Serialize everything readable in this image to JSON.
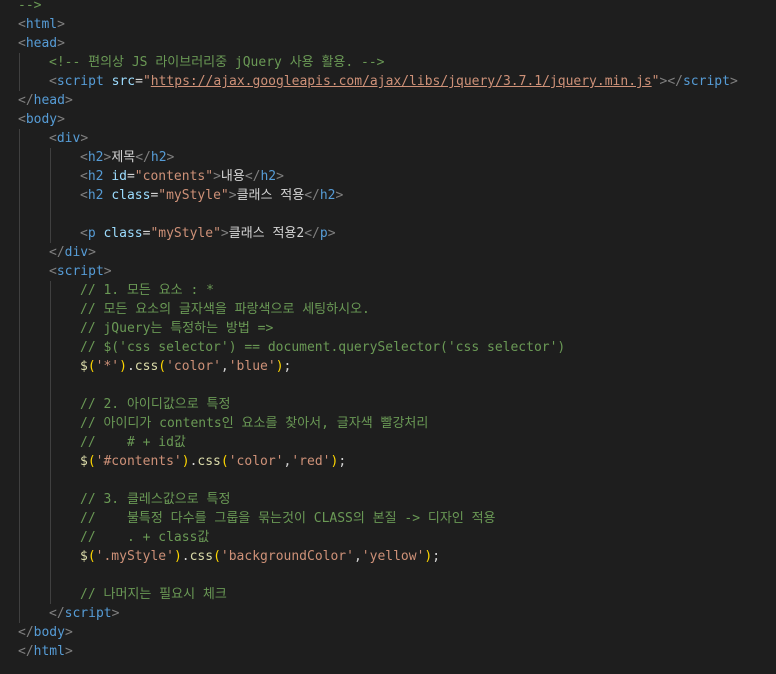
{
  "editor": {
    "language": "html",
    "colors": {
      "background": "#1e1e1e",
      "tag": "#569cd6",
      "punctuation": "#808080",
      "attribute": "#9cdcfe",
      "string": "#ce9178",
      "comment": "#6a9955",
      "text": "#d4d4d4",
      "function": "#dcdcaa",
      "bracket": "#ffd700",
      "bracket_inner": "#da70d6"
    },
    "lines": [
      {
        "indent": 0,
        "tokens": [
          {
            "t": "-->",
            "c": "tok-comment"
          }
        ]
      },
      {
        "indent": 0,
        "tokens": [
          {
            "t": "<",
            "c": "tok-punc"
          },
          {
            "t": "html",
            "c": "tok-tag"
          },
          {
            "t": ">",
            "c": "tok-punc"
          }
        ]
      },
      {
        "indent": 0,
        "tokens": [
          {
            "t": "<",
            "c": "tok-punc"
          },
          {
            "t": "head",
            "c": "tok-tag"
          },
          {
            "t": ">",
            "c": "tok-punc"
          }
        ]
      },
      {
        "indent": 1,
        "tokens": [
          {
            "t": "<!-- 편의상 JS 라이브러리중 jQuery 사용 활용. -->",
            "c": "tok-comment"
          }
        ]
      },
      {
        "indent": 1,
        "tokens": [
          {
            "t": "<",
            "c": "tok-punc"
          },
          {
            "t": "script",
            "c": "tok-tag"
          },
          {
            "t": " ",
            "c": "tok-text"
          },
          {
            "t": "src",
            "c": "tok-attr"
          },
          {
            "t": "=",
            "c": "tok-text"
          },
          {
            "t": "\"",
            "c": "tok-str"
          },
          {
            "t": "https://ajax.googleapis.com/ajax/libs/jquery/3.7.1/jquery.min.js",
            "c": "tok-url"
          },
          {
            "t": "\"",
            "c": "tok-str"
          },
          {
            "t": "></",
            "c": "tok-punc"
          },
          {
            "t": "script",
            "c": "tok-tag"
          },
          {
            "t": ">",
            "c": "tok-punc"
          }
        ]
      },
      {
        "indent": 0,
        "tokens": [
          {
            "t": "</",
            "c": "tok-punc"
          },
          {
            "t": "head",
            "c": "tok-tag"
          },
          {
            "t": ">",
            "c": "tok-punc"
          }
        ]
      },
      {
        "indent": 0,
        "tokens": [
          {
            "t": "<",
            "c": "tok-punc"
          },
          {
            "t": "body",
            "c": "tok-tag"
          },
          {
            "t": ">",
            "c": "tok-punc"
          }
        ]
      },
      {
        "indent": 1,
        "tokens": [
          {
            "t": "<",
            "c": "tok-punc"
          },
          {
            "t": "div",
            "c": "tok-tag"
          },
          {
            "t": ">",
            "c": "tok-punc"
          }
        ]
      },
      {
        "indent": 2,
        "tokens": [
          {
            "t": "<",
            "c": "tok-punc"
          },
          {
            "t": "h2",
            "c": "tok-tag"
          },
          {
            "t": ">",
            "c": "tok-punc"
          },
          {
            "t": "제목",
            "c": "tok-text"
          },
          {
            "t": "</",
            "c": "tok-punc"
          },
          {
            "t": "h2",
            "c": "tok-tag"
          },
          {
            "t": ">",
            "c": "tok-punc"
          }
        ]
      },
      {
        "indent": 2,
        "tokens": [
          {
            "t": "<",
            "c": "tok-punc"
          },
          {
            "t": "h2",
            "c": "tok-tag"
          },
          {
            "t": " ",
            "c": "tok-text"
          },
          {
            "t": "id",
            "c": "tok-attr"
          },
          {
            "t": "=",
            "c": "tok-text"
          },
          {
            "t": "\"contents\"",
            "c": "tok-str"
          },
          {
            "t": ">",
            "c": "tok-punc"
          },
          {
            "t": "내용",
            "c": "tok-text"
          },
          {
            "t": "</",
            "c": "tok-punc"
          },
          {
            "t": "h2",
            "c": "tok-tag"
          },
          {
            "t": ">",
            "c": "tok-punc"
          }
        ]
      },
      {
        "indent": 2,
        "tokens": [
          {
            "t": "<",
            "c": "tok-punc"
          },
          {
            "t": "h2",
            "c": "tok-tag"
          },
          {
            "t": " ",
            "c": "tok-text"
          },
          {
            "t": "class",
            "c": "tok-attr"
          },
          {
            "t": "=",
            "c": "tok-text"
          },
          {
            "t": "\"myStyle\"",
            "c": "tok-str"
          },
          {
            "t": ">",
            "c": "tok-punc"
          },
          {
            "t": "클래스 적용",
            "c": "tok-text"
          },
          {
            "t": "</",
            "c": "tok-punc"
          },
          {
            "t": "h2",
            "c": "tok-tag"
          },
          {
            "t": ">",
            "c": "tok-punc"
          }
        ]
      },
      {
        "indent": 2,
        "tokens": []
      },
      {
        "indent": 2,
        "tokens": [
          {
            "t": "<",
            "c": "tok-punc"
          },
          {
            "t": "p",
            "c": "tok-tag"
          },
          {
            "t": " ",
            "c": "tok-text"
          },
          {
            "t": "class",
            "c": "tok-attr"
          },
          {
            "t": "=",
            "c": "tok-text"
          },
          {
            "t": "\"myStyle\"",
            "c": "tok-str"
          },
          {
            "t": ">",
            "c": "tok-punc"
          },
          {
            "t": "클래스 적용2",
            "c": "tok-text"
          },
          {
            "t": "</",
            "c": "tok-punc"
          },
          {
            "t": "p",
            "c": "tok-tag"
          },
          {
            "t": ">",
            "c": "tok-punc"
          }
        ]
      },
      {
        "indent": 1,
        "tokens": [
          {
            "t": "</",
            "c": "tok-punc"
          },
          {
            "t": "div",
            "c": "tok-tag"
          },
          {
            "t": ">",
            "c": "tok-punc"
          }
        ]
      },
      {
        "indent": 1,
        "tokens": [
          {
            "t": "<",
            "c": "tok-punc"
          },
          {
            "t": "script",
            "c": "tok-tag"
          },
          {
            "t": ">",
            "c": "tok-punc"
          }
        ]
      },
      {
        "indent": 2,
        "tokens": [
          {
            "t": "// 1. 모든 요소 : *",
            "c": "tok-comment"
          }
        ]
      },
      {
        "indent": 2,
        "tokens": [
          {
            "t": "// 모든 요소의 글자색을 파랑색으로 세팅하시오.",
            "c": "tok-comment"
          }
        ]
      },
      {
        "indent": 2,
        "tokens": [
          {
            "t": "// jQuery는 특정하는 방법 =>",
            "c": "tok-comment"
          }
        ]
      },
      {
        "indent": 2,
        "tokens": [
          {
            "t": "// $('css selector') == document.querySelector('css selector')",
            "c": "tok-comment"
          }
        ]
      },
      {
        "indent": 2,
        "tokens": [
          {
            "t": "$",
            "c": "tok-fn"
          },
          {
            "t": "(",
            "c": "tok-brk"
          },
          {
            "t": "'*'",
            "c": "tok-str"
          },
          {
            "t": ")",
            "c": "tok-brk"
          },
          {
            "t": ".",
            "c": "tok-text"
          },
          {
            "t": "css",
            "c": "tok-fn"
          },
          {
            "t": "(",
            "c": "tok-brk"
          },
          {
            "t": "'color'",
            "c": "tok-str"
          },
          {
            "t": ",",
            "c": "tok-text"
          },
          {
            "t": "'blue'",
            "c": "tok-str"
          },
          {
            "t": ")",
            "c": "tok-brk"
          },
          {
            "t": ";",
            "c": "tok-text"
          }
        ]
      },
      {
        "indent": 2,
        "tokens": []
      },
      {
        "indent": 2,
        "tokens": [
          {
            "t": "// 2. 아이디값으로 특정",
            "c": "tok-comment"
          }
        ]
      },
      {
        "indent": 2,
        "tokens": [
          {
            "t": "// 아이디가 contents인 요소를 찾아서, 글자색 빨강처리",
            "c": "tok-comment"
          }
        ]
      },
      {
        "indent": 2,
        "tokens": [
          {
            "t": "//    # + id값",
            "c": "tok-comment"
          }
        ]
      },
      {
        "indent": 2,
        "tokens": [
          {
            "t": "$",
            "c": "tok-fn"
          },
          {
            "t": "(",
            "c": "tok-brk"
          },
          {
            "t": "'#contents'",
            "c": "tok-str"
          },
          {
            "t": ")",
            "c": "tok-brk"
          },
          {
            "t": ".",
            "c": "tok-text"
          },
          {
            "t": "css",
            "c": "tok-fn"
          },
          {
            "t": "(",
            "c": "tok-brk"
          },
          {
            "t": "'color'",
            "c": "tok-str"
          },
          {
            "t": ",",
            "c": "tok-text"
          },
          {
            "t": "'red'",
            "c": "tok-str"
          },
          {
            "t": ")",
            "c": "tok-brk"
          },
          {
            "t": ";",
            "c": "tok-text"
          }
        ]
      },
      {
        "indent": 2,
        "tokens": []
      },
      {
        "indent": 2,
        "tokens": [
          {
            "t": "// 3. 클레스값으로 특정",
            "c": "tok-comment"
          }
        ]
      },
      {
        "indent": 2,
        "tokens": [
          {
            "t": "//    불특정 다수를 그룹을 묶는것이 CLASS의 본질 -> 디자인 적용",
            "c": "tok-comment"
          }
        ]
      },
      {
        "indent": 2,
        "tokens": [
          {
            "t": "//    . + class값",
            "c": "tok-comment"
          }
        ]
      },
      {
        "indent": 2,
        "tokens": [
          {
            "t": "$",
            "c": "tok-fn"
          },
          {
            "t": "(",
            "c": "tok-brk"
          },
          {
            "t": "'.myStyle'",
            "c": "tok-str"
          },
          {
            "t": ")",
            "c": "tok-brk"
          },
          {
            "t": ".",
            "c": "tok-text"
          },
          {
            "t": "css",
            "c": "tok-fn"
          },
          {
            "t": "(",
            "c": "tok-brk"
          },
          {
            "t": "'backgroundColor'",
            "c": "tok-str"
          },
          {
            "t": ",",
            "c": "tok-text"
          },
          {
            "t": "'yellow'",
            "c": "tok-str"
          },
          {
            "t": ")",
            "c": "tok-brk"
          },
          {
            "t": ";",
            "c": "tok-text"
          }
        ]
      },
      {
        "indent": 2,
        "tokens": []
      },
      {
        "indent": 2,
        "tokens": [
          {
            "t": "// 나머지는 필요시 체크",
            "c": "tok-comment"
          }
        ]
      },
      {
        "indent": 1,
        "tokens": [
          {
            "t": "</",
            "c": "tok-punc"
          },
          {
            "t": "script",
            "c": "tok-tag"
          },
          {
            "t": ">",
            "c": "tok-punc"
          }
        ]
      },
      {
        "indent": 0,
        "tokens": [
          {
            "t": "</",
            "c": "tok-punc"
          },
          {
            "t": "body",
            "c": "tok-tag"
          },
          {
            "t": ">",
            "c": "tok-punc"
          }
        ]
      },
      {
        "indent": 0,
        "tokens": [
          {
            "t": "</",
            "c": "tok-punc"
          },
          {
            "t": "html",
            "c": "tok-tag"
          },
          {
            "t": ">",
            "c": "tok-punc"
          }
        ]
      }
    ]
  }
}
